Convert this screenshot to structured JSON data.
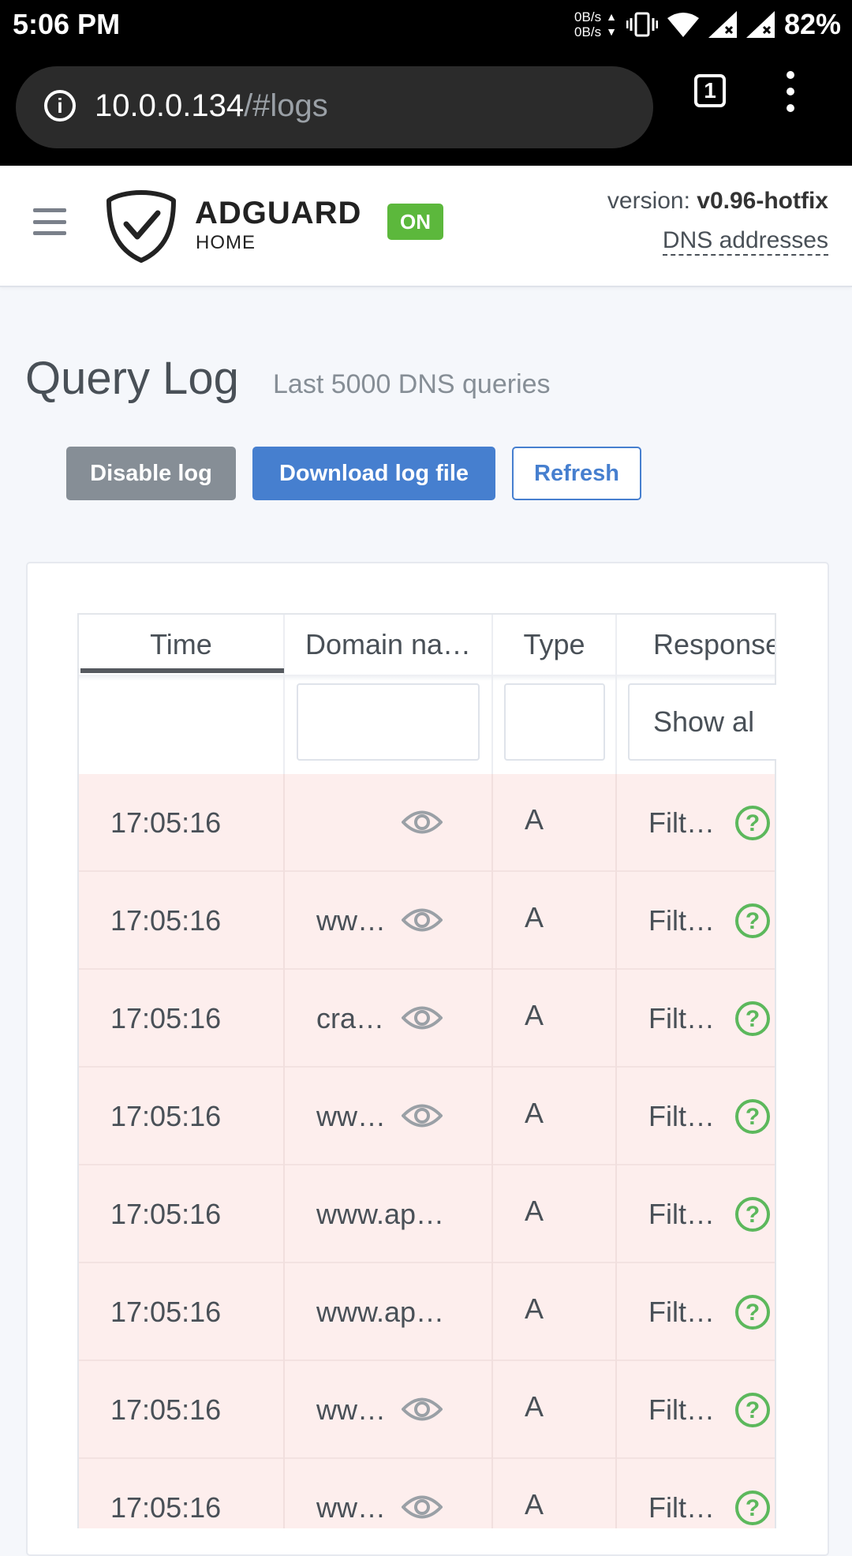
{
  "status_bar": {
    "time": "5:06 PM",
    "speed_up": "0B/s",
    "speed_down": "0B/s",
    "battery": "82%",
    "icons": [
      "vibrate-icon",
      "wifi-icon",
      "signal-icon",
      "signal-icon",
      "battery-icon"
    ]
  },
  "browser": {
    "url_host": "10.0.0.134",
    "url_path": "/#logs",
    "tab_count": "1"
  },
  "header": {
    "logo_word": "ADGUARD",
    "logo_sub": "HOME",
    "status_badge": "ON",
    "version_label": "version: ",
    "version_value": "v0.96-hotfix",
    "dns_link": "DNS addresses"
  },
  "page": {
    "title": "Query Log",
    "subtitle": "Last 5000 DNS queries"
  },
  "buttons": {
    "disable": "Disable log",
    "download": "Download log file",
    "refresh": "Refresh"
  },
  "table": {
    "columns": [
      "Time",
      "Domain na…",
      "Type",
      "Response"
    ],
    "response_filter": "Show al",
    "rows": [
      {
        "time": "17:05:16",
        "domain": "",
        "type": "A",
        "response": "Filt…",
        "eye": true
      },
      {
        "time": "17:05:16",
        "domain": "ww…",
        "type": "A",
        "response": "Filt…",
        "eye": true
      },
      {
        "time": "17:05:16",
        "domain": "cra…",
        "type": "A",
        "response": "Filt…",
        "eye": true
      },
      {
        "time": "17:05:16",
        "domain": "ww…",
        "type": "A",
        "response": "Filt…",
        "eye": true
      },
      {
        "time": "17:05:16",
        "domain": "www.ap…",
        "type": "A",
        "response": "Filt…",
        "eye": false
      },
      {
        "time": "17:05:16",
        "domain": "www.ap…",
        "type": "A",
        "response": "Filt…",
        "eye": false
      },
      {
        "time": "17:05:16",
        "domain": "ww…",
        "type": "A",
        "response": "Filt…",
        "eye": true
      },
      {
        "time": "17:05:16",
        "domain": "ww…",
        "type": "A",
        "response": "Filt…",
        "eye": true
      }
    ]
  },
  "colors": {
    "primary": "#467fcf",
    "secondary": "#868e96",
    "success": "#5cb85c",
    "row_blocked": "#fdeeed",
    "badge_on": "#5cb83c"
  }
}
